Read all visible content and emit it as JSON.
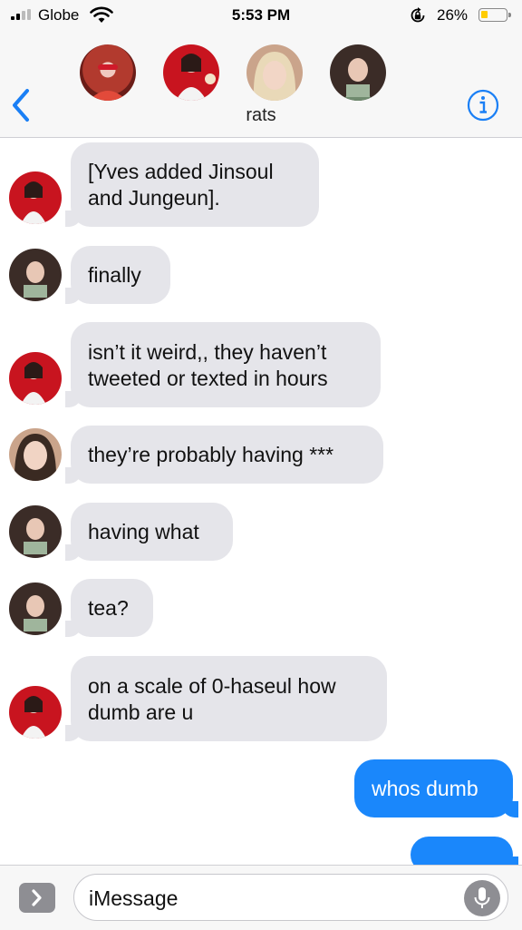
{
  "status_bar": {
    "carrier": "Globe",
    "time": "5:53 PM",
    "battery_percent": "26%",
    "battery_level": 0.26,
    "battery_color": "#ffcc00"
  },
  "header": {
    "title": "rats",
    "icons": [
      "back-chevron-icon",
      "info-icon"
    ],
    "accent_color": "#1a7ff5"
  },
  "messages": [
    {
      "direction": "incoming",
      "text": "[Yves added Jinsoul\nand Jungeun]."
    },
    {
      "direction": "incoming",
      "text": "finally"
    },
    {
      "direction": "incoming",
      "text": "isn’t it weird,, they haven’t\ntweeted or texted in hours"
    },
    {
      "direction": "incoming",
      "text": "they’re probably having ***"
    },
    {
      "direction": "incoming",
      "text": "having what"
    },
    {
      "direction": "incoming",
      "text": "tea?"
    },
    {
      "direction": "incoming",
      "text": "on a scale of 0-haseul how\ndumb are u"
    },
    {
      "direction": "outgoing",
      "text": "whos dumb"
    }
  ],
  "composer": {
    "placeholder": "iMessage",
    "outgoing_color": "#1a87fb"
  }
}
